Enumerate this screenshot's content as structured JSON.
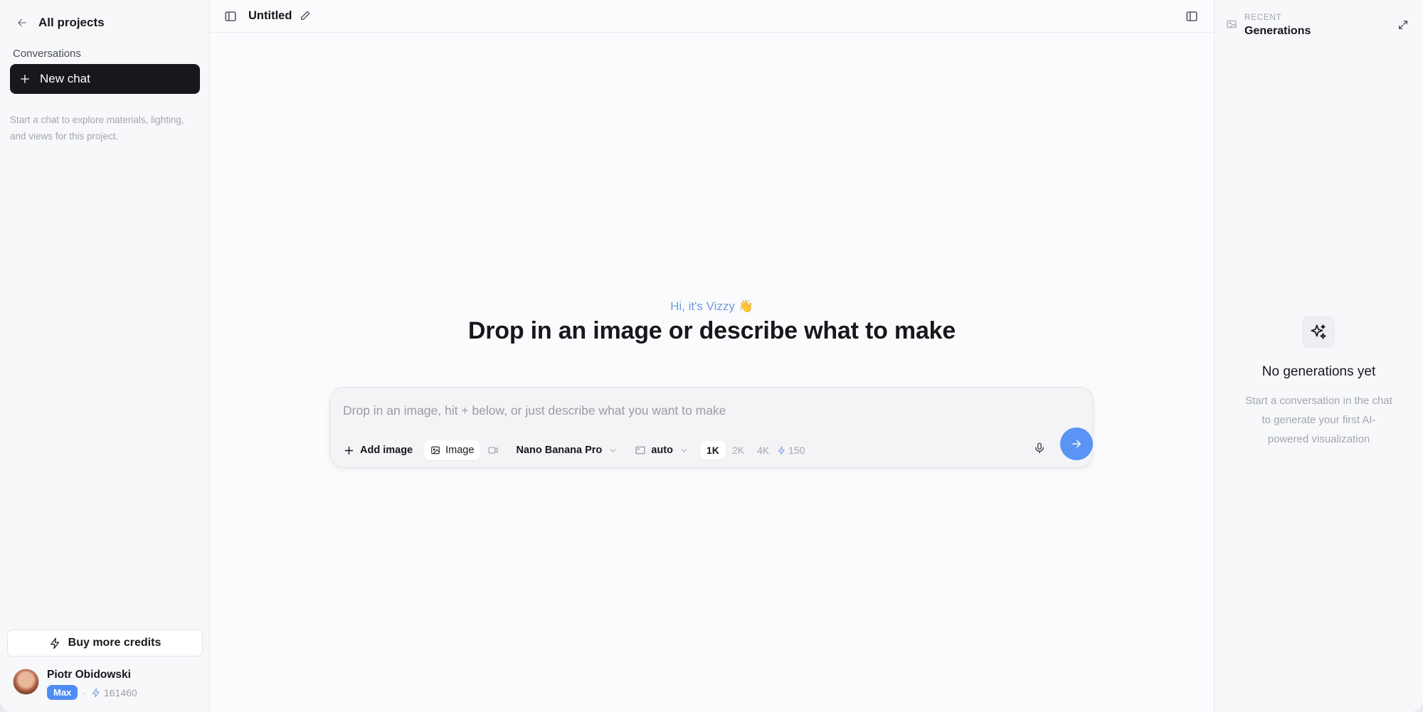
{
  "sidebar": {
    "back_label": "All projects",
    "section_heading": "Conversations",
    "new_chat_label": "New chat",
    "hint": "Start a chat to explore materials, lighting, and views for this project.",
    "buy_credits_label": "Buy more credits",
    "user": {
      "name": "Piotr Obidowski",
      "plan": "Max",
      "credits": "161460"
    }
  },
  "header": {
    "title": "Untitled"
  },
  "main": {
    "greeting": "Hi, it's Vizzy 👋",
    "headline": "Drop in an image or describe what to make",
    "composer": {
      "placeholder": "Drop in an image, hit + below, or just describe what you want to make",
      "value": "",
      "add_image_label": "Add image",
      "mode_image_label": "Image",
      "model": "Nano Banana Pro",
      "aspect": "auto",
      "resolutions": [
        "1K",
        "2K",
        "4K"
      ],
      "selected_resolution": "1K",
      "cost": "150"
    }
  },
  "right_panel": {
    "kicker": "RECENT",
    "title": "Generations",
    "empty_title": "No generations yet",
    "empty_text": "Start a conversation in the chat to generate your first AI-powered visualization"
  },
  "colors": {
    "accent": "#5a95f5",
    "greeting": "#6d9be0",
    "dark": "#17181c"
  },
  "icons": [
    "arrow-left-icon",
    "plus-icon",
    "bolt-icon",
    "sidebar-toggle-icon",
    "pencil-icon",
    "image-icon",
    "video-icon",
    "chevron-down-icon",
    "aspect-frame-icon",
    "microphone-icon",
    "arrow-right-icon",
    "gallery-icon",
    "expand-icon",
    "sparkles-icon"
  ]
}
